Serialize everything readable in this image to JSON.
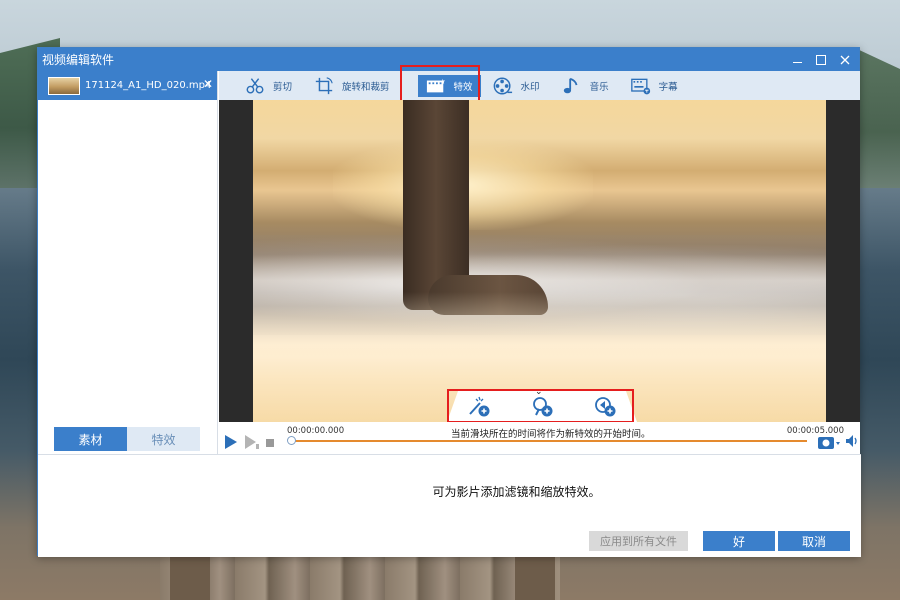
{
  "window": {
    "title": "视频编辑软件",
    "controls": [
      "minimize",
      "maximize",
      "close"
    ]
  },
  "file_list": {
    "items": [
      {
        "name": "171124_A1_HD_020.mp4",
        "selected": true
      }
    ]
  },
  "left_tabs": [
    {
      "label": "素材",
      "active": true
    },
    {
      "label": "特效",
      "active": false
    }
  ],
  "toolbar": {
    "items": [
      {
        "label": "剪切",
        "icon": "scissors-icon",
        "active": false
      },
      {
        "label": "旋转和裁剪",
        "icon": "crop-rotate-icon",
        "active": false
      },
      {
        "label": "特效",
        "icon": "film-sparkle-icon",
        "active": true
      },
      {
        "label": "水印",
        "icon": "watermark-reel-icon",
        "active": false
      },
      {
        "label": "音乐",
        "icon": "music-note-icon",
        "active": false
      },
      {
        "label": "字幕",
        "icon": "subtitle-icon",
        "active": false
      }
    ]
  },
  "effects_panel": {
    "buttons": [
      {
        "icon": "add-filter-wand-icon"
      },
      {
        "icon": "add-zoom-magnifier-icon"
      },
      {
        "icon": "add-playback-icon"
      }
    ]
  },
  "player": {
    "time_start": "00:00:00.000",
    "time_end": "00:00:05.000",
    "hint": "当前滑块所在的时间将作为新特效的开始时间。",
    "progress": 0.0
  },
  "info_text": "可为影片添加滤镜和缩放特效。",
  "buttons": {
    "apply_all": "应用到所有文件",
    "ok": "好",
    "cancel": "取消"
  },
  "colors": {
    "accent": "#3b7fcb",
    "toolbar_bg": "#dfe9f4",
    "highlight": "#e51e1e",
    "track": "#e58a2e"
  }
}
